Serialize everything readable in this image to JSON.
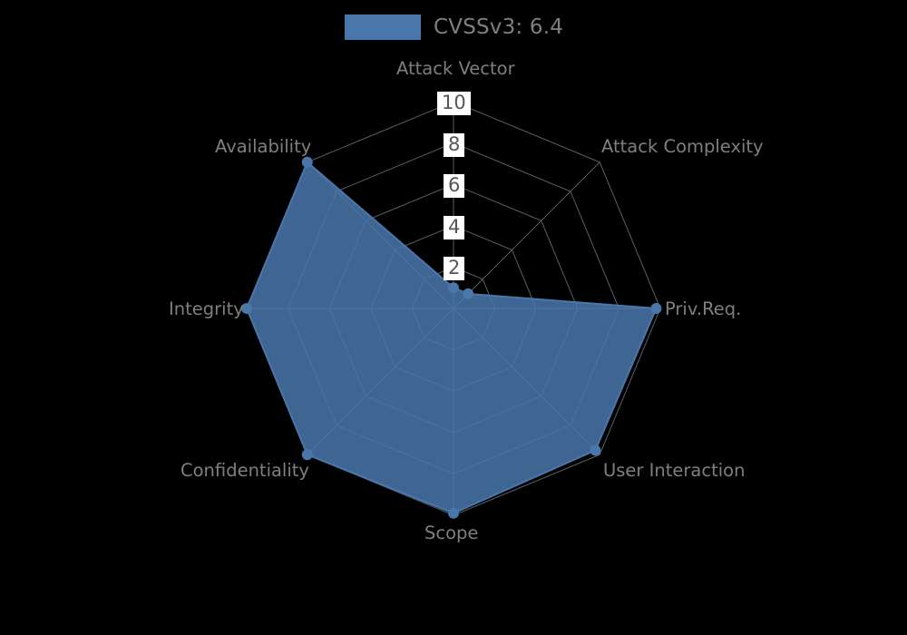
{
  "background_color": "#000000",
  "legend": {
    "label": "CVSSv3: 6.4",
    "swatch_color": "#4a77ab",
    "position": "top-center"
  },
  "chart_data": {
    "type": "radar",
    "title": "",
    "subtitle": "",
    "xlabel": "",
    "ylabel": "",
    "categories": [
      "Attack Vector",
      "Attack Complexity",
      "Priv.Req.",
      "User Interaction",
      "Scope",
      "Confidentiality",
      "Integrity",
      "Availability"
    ],
    "series": [
      {
        "name": "CVSSv3: 6.4",
        "color": "#4a77ab",
        "values": [
          1.0,
          1.0,
          9.8,
          9.7,
          9.9,
          10.0,
          10.0,
          10.0
        ]
      }
    ],
    "tick_labels": [
      "2",
      "4",
      "6",
      "8",
      "10"
    ],
    "tick_values": [
      2,
      4,
      6,
      8,
      10
    ],
    "rlim": [
      0,
      10
    ],
    "grid": true,
    "legend_position": "top-center",
    "marker": "circle",
    "fill_opacity": 0.85
  },
  "axis_labels": {
    "attack_vector": "Attack Vector",
    "attack_complexity": "Attack Complexity",
    "priv_req": "Priv.Req.",
    "user_interaction": "User Interaction",
    "scope": "Scope",
    "confidentiality": "Confidentiality",
    "integrity": "Integrity",
    "availability": "Availability"
  },
  "ticks": {
    "t10": "10",
    "t8": "8",
    "t6": "6",
    "t4": "4",
    "t2": "2"
  },
  "colors": {
    "series": "#4a77ab",
    "grid": "#55606b",
    "text": "#7f7f7f",
    "tick_text": "#555555",
    "tick_bg": "#ffffff",
    "background": "#000000"
  }
}
